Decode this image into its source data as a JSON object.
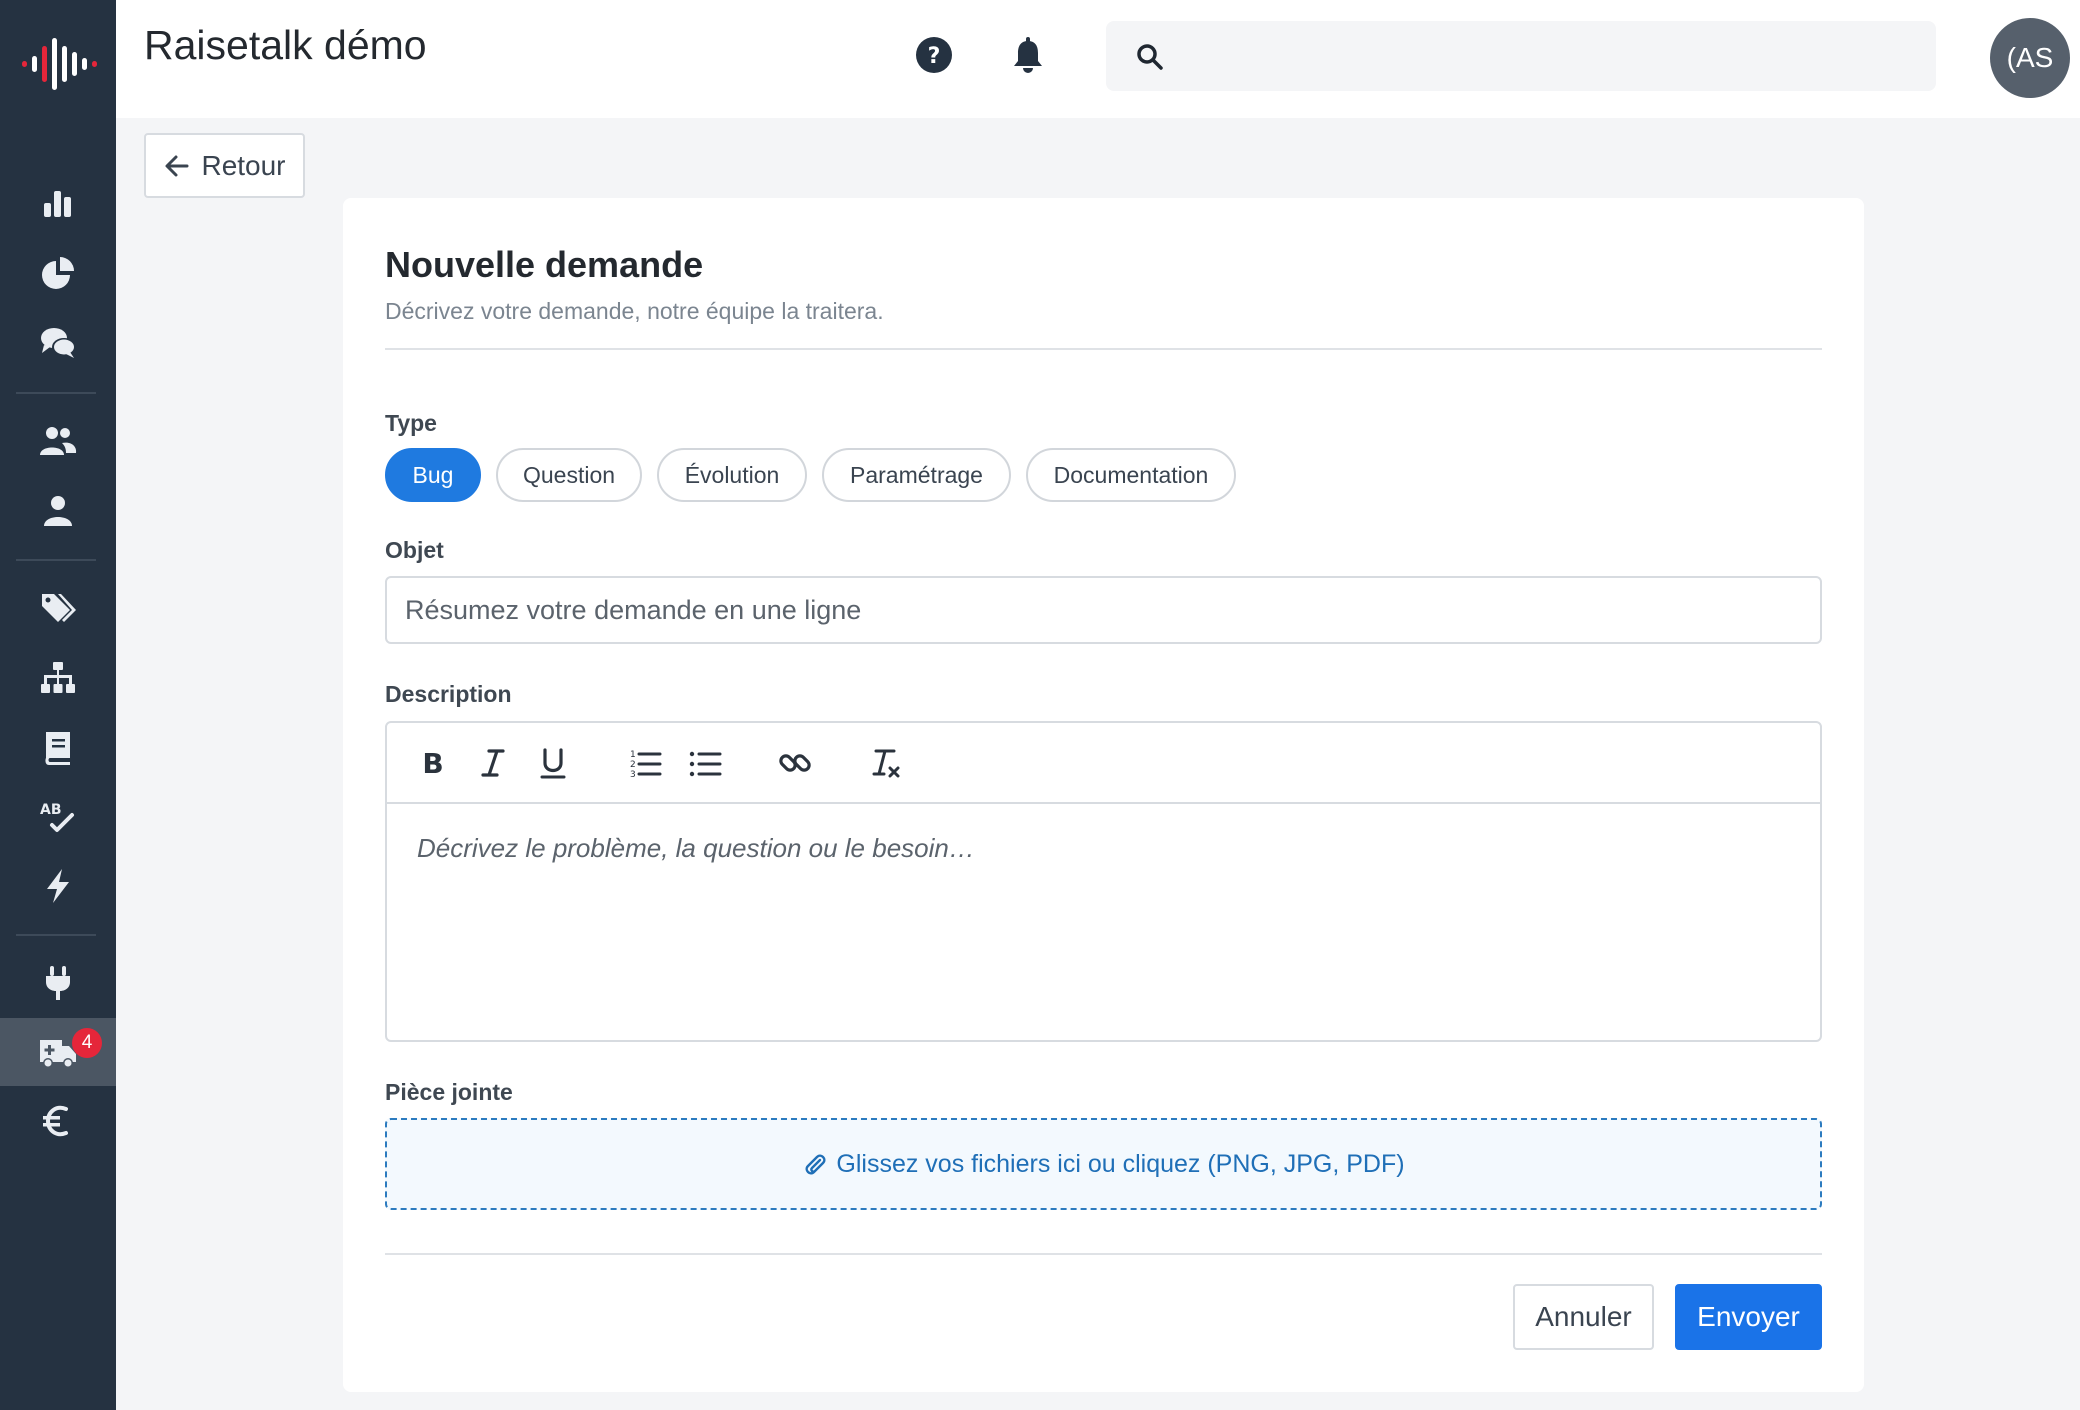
{
  "header": {
    "app_title": "Raisetalk démo",
    "search_placeholder": "",
    "avatar_initials": "(AS"
  },
  "sidebar": {
    "items": [
      {
        "icon": "bar-chart-icon"
      },
      {
        "icon": "pie-chart-icon"
      },
      {
        "icon": "chat-icon"
      },
      {
        "icon": "users-icon"
      },
      {
        "icon": "user-icon"
      },
      {
        "icon": "tags-icon"
      },
      {
        "icon": "sitemap-icon"
      },
      {
        "icon": "book-icon"
      },
      {
        "icon": "spellcheck-icon"
      },
      {
        "icon": "bolt-icon"
      },
      {
        "icon": "plug-icon"
      },
      {
        "icon": "ambulance-icon",
        "badge": "4",
        "active": true
      },
      {
        "icon": "euro-icon"
      }
    ]
  },
  "back_button": {
    "label": "Retour"
  },
  "form": {
    "title": "Nouvelle demande",
    "subtitle": "Décrivez votre demande, notre équipe la traitera.",
    "type": {
      "label": "Type",
      "options": [
        "Bug",
        "Question",
        "Évolution",
        "Paramétrage",
        "Documentation"
      ],
      "selected": "Bug"
    },
    "subject": {
      "label": "Objet",
      "value": "",
      "placeholder": "Résumez votre demande en une ligne"
    },
    "description": {
      "label": "Description",
      "placeholder": "Décrivez le problème, la question ou le besoin…",
      "toolbar": [
        "bold",
        "italic",
        "underline",
        "ordered-list",
        "bullet-list",
        "link",
        "clear-format"
      ]
    },
    "attachment": {
      "label": "Pièce jointe",
      "dropzone_text": "Glissez vos fichiers ici ou cliquez (PNG, JPG, PDF)"
    },
    "actions": {
      "cancel_label": "Annuler",
      "submit_label": "Envoyer"
    }
  },
  "colors": {
    "sidebar_bg": "#253241",
    "accent": "#1a73e8",
    "badge": "#e5263a",
    "logo_red": "#e5263a"
  }
}
